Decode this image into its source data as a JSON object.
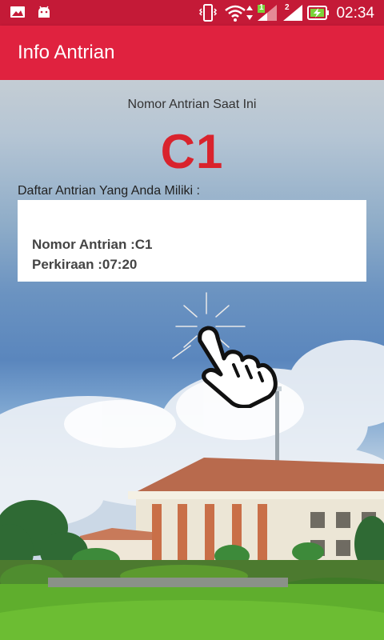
{
  "status_bar": {
    "time": "02:34",
    "sim1_label": "1",
    "sim2_label": "2",
    "icons": [
      "gallery-icon",
      "android-icon",
      "vibrate-icon",
      "wifi-icon",
      "signal-sim1-icon",
      "signal-sim2-icon",
      "battery-charging-icon"
    ]
  },
  "app_bar": {
    "title": "Info Antrian"
  },
  "queue": {
    "current_label": "Nomor Antrian Saat Ini",
    "current_number": "C1",
    "list_label": "Daftar Antrian Yang Anda Miliki :",
    "items": [
      {
        "number_line": "Nomor Antrian :C1",
        "estimate_line": "Perkiraan :07:20"
      }
    ]
  },
  "colors": {
    "status_bar": "#c41a37",
    "app_bar": "#e0223f",
    "current_number": "#d9232d"
  }
}
